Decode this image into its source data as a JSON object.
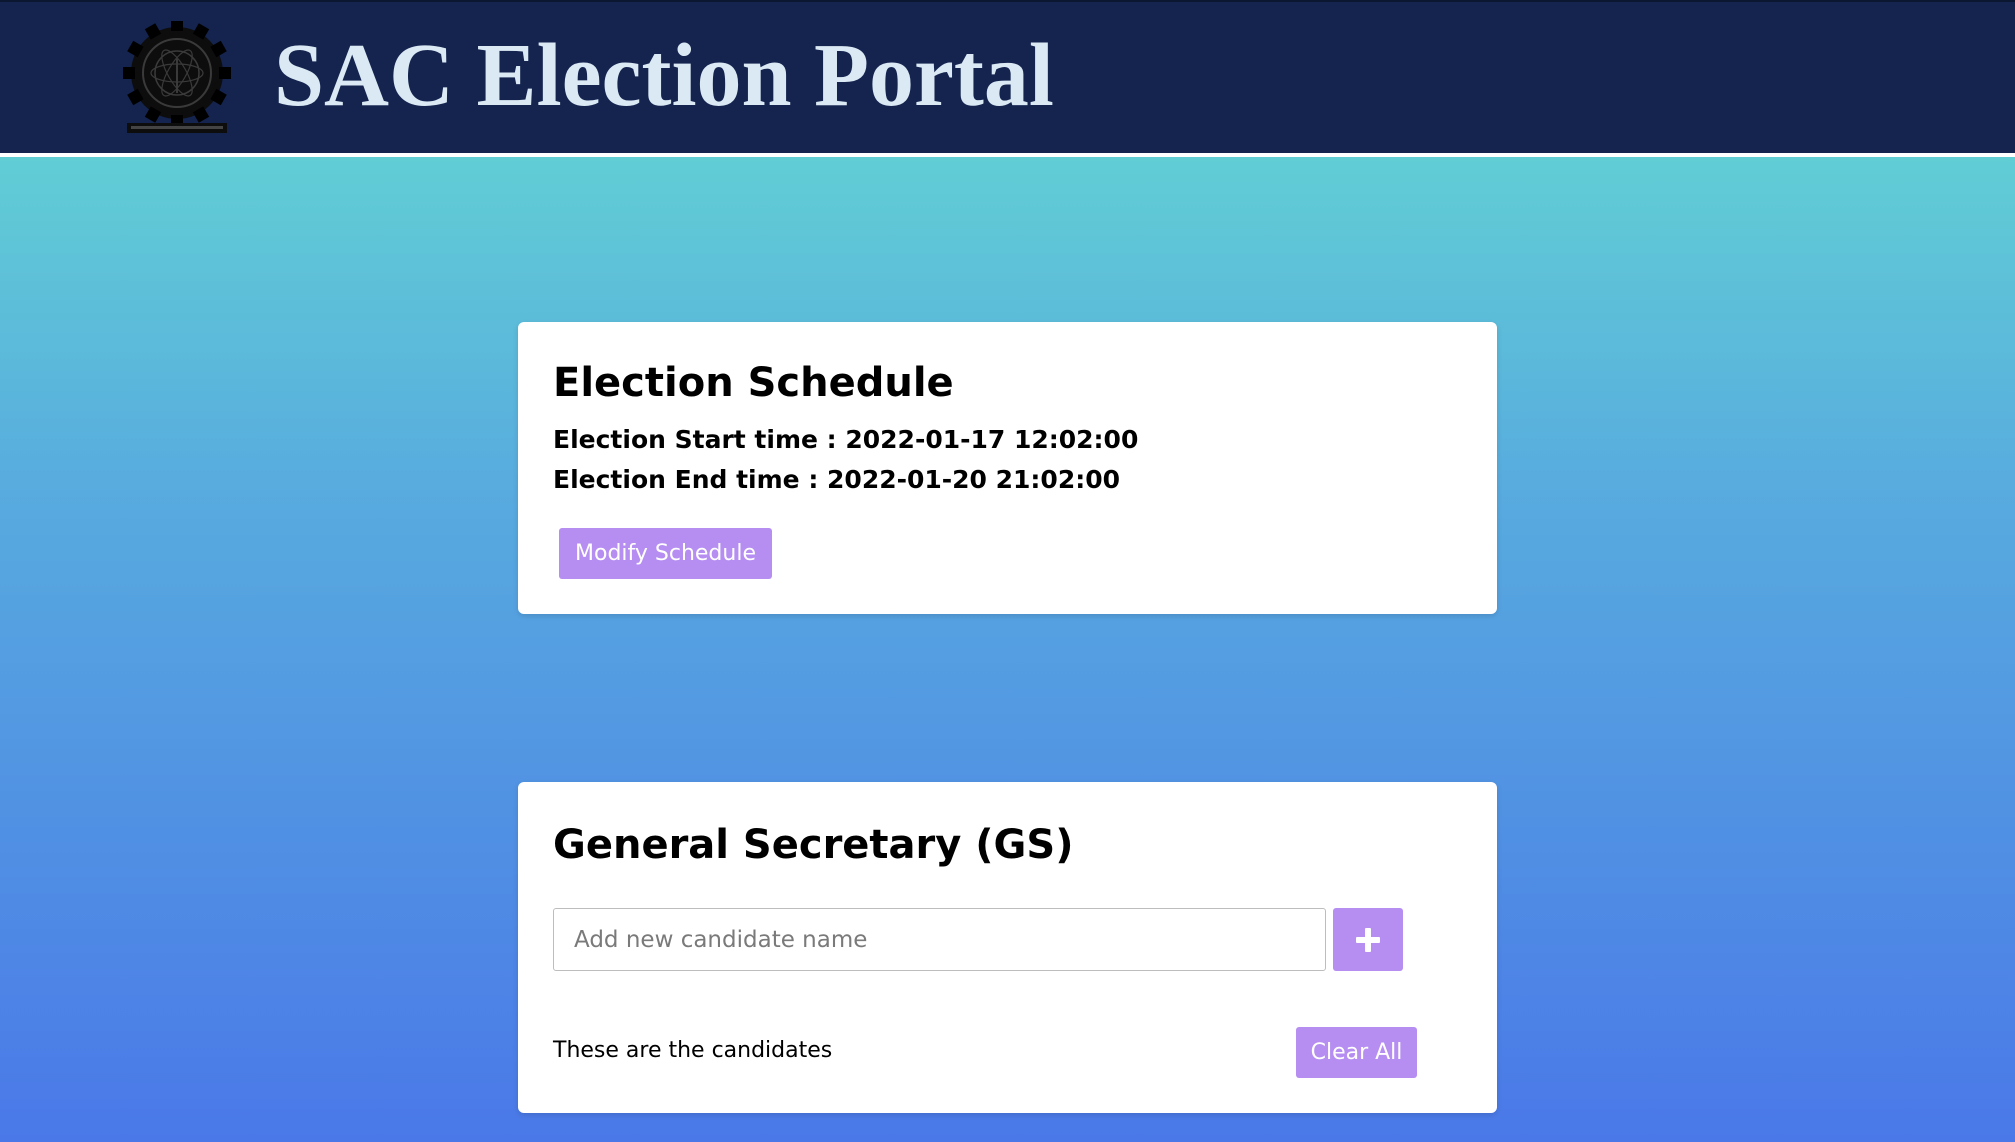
{
  "header": {
    "title": "SAC Election Portal",
    "logo_icon": "institute-seal-icon",
    "background_color": "#14244f",
    "title_color": "#dbe9f4"
  },
  "schedule": {
    "heading": "Election Schedule",
    "start_line": "Election Start time : 2022-01-17 12:02:00",
    "end_line": "Election End time : 2022-01-20 21:02:00",
    "modify_button_label": "Modify Schedule"
  },
  "position_card": {
    "heading": "General Secretary (GS)",
    "input_placeholder": "Add new candidate name",
    "input_value": "",
    "add_button_icon": "plus-icon",
    "candidates_label": "These are the candidates",
    "clear_button_label": "Clear All"
  },
  "theme": {
    "accent": "#b68ef2",
    "gradient_top": "#65ddd0",
    "gradient_bottom": "#4a78e8"
  }
}
